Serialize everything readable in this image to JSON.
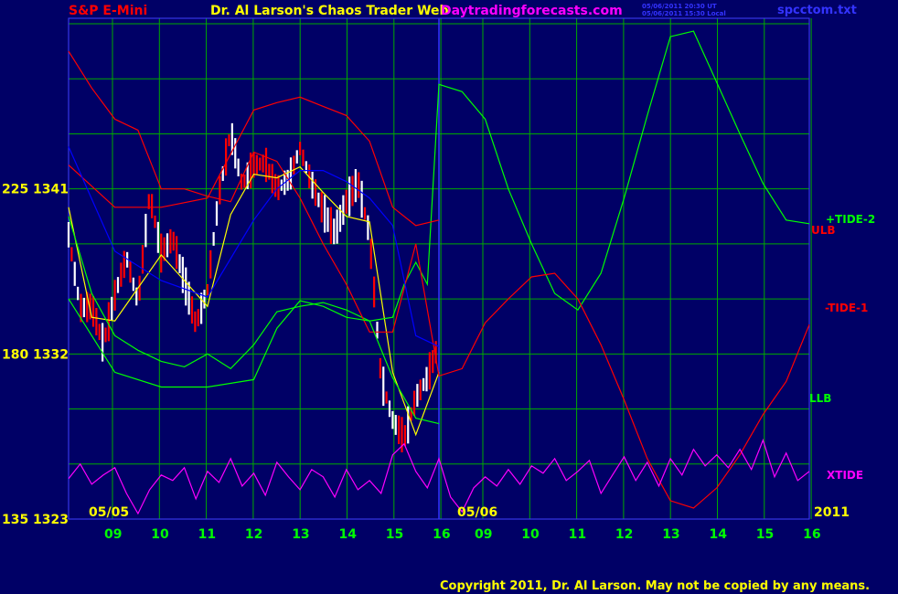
{
  "header": {
    "instrument": "S&P E-Mini",
    "title": "Dr. Al Larson's Chaos Trader Web",
    "site": "Daytradingforecasts.com",
    "timestamp_ut": "05/06/2011 20:30 UT",
    "timestamp_local": "05/06/2011 15:30 Local",
    "file": "spcctom.txt"
  },
  "footer": {
    "copyright": "Copyright 2011, Dr. Al Larson.  May not be copied by any means."
  },
  "colors": {
    "background": "#000066",
    "grid": "#00AA00",
    "price_up": "#FFFFFF",
    "price_down": "#FF0000",
    "tide2": "#00FF00",
    "tide1": "#FF0000",
    "ulb": "#FF0000",
    "llb": "#00FF00",
    "xtide": "#FF00FF",
    "blue_avg": "#0000FF",
    "yellow_avg": "#FFFF00",
    "title_yellow": "#FFFF00",
    "label_green": "#00FF00",
    "label_red": "#FF0000",
    "label_magenta": "#FF00FF",
    "label_blue": "#0000FF"
  },
  "chart_data": {
    "type": "line",
    "y_axis": {
      "ticks": [
        {
          "left": "225",
          "right": "1341",
          "price": 1341
        },
        {
          "left": "180",
          "right": "1332",
          "price": 1332
        },
        {
          "left": "135",
          "right": "1323",
          "price": 1323
        }
      ],
      "ylim": [
        1323,
        1350.3
      ]
    },
    "x_axis": {
      "hours_day1": [
        "09",
        "10",
        "11",
        "12",
        "13",
        "14",
        "15",
        "16"
      ],
      "hours_day2": [
        "09",
        "10",
        "11",
        "12",
        "13",
        "14",
        "15",
        "16"
      ],
      "date_labels": [
        "05/05",
        "05/06",
        "2011"
      ]
    },
    "right_labels": [
      "+TIDE-2",
      "ULB",
      "-TIDE-1",
      "LLB",
      "XTIDE"
    ],
    "series": [
      {
        "name": "+TIDE-2",
        "x": [
          0,
          0.5,
          1,
          1.5,
          2,
          2.5,
          3,
          3.5,
          4,
          4.5,
          5,
          5.5,
          6,
          6.5,
          7,
          7.25,
          7.5,
          7.75,
          8,
          8.5,
          9,
          9.5,
          10,
          10.5,
          11,
          11.5,
          12,
          12.5,
          13,
          13.5,
          14,
          14.5,
          15,
          15.5,
          16
        ],
        "y": [
          1339.5,
          1335.3,
          1333,
          1332.2,
          1331.6,
          1331.3,
          1332,
          1331.2,
          1332.5,
          1334.3,
          1334.6,
          1334.8,
          1334.4,
          1333.8,
          1334,
          1335.8,
          1337,
          1335.8,
          1346.7,
          1346.3,
          1344.8,
          1341,
          1338,
          1335.3,
          1334.4,
          1336.4,
          1340.5,
          1345,
          1349.3,
          1349.6,
          1346.8,
          1344,
          1341.3,
          1339.3,
          1339.1
        ]
      },
      {
        "name": "-TIDE-1",
        "x": [
          0,
          0.5,
          1,
          1.5,
          2,
          2.5,
          3,
          3.5,
          4,
          4.5,
          5,
          5.5,
          6,
          6.5,
          7,
          7.5,
          8,
          8.5,
          9,
          9.5,
          10,
          10.5,
          11,
          11.5,
          12,
          12.5,
          13,
          13.5,
          14,
          14.5,
          15,
          15.5,
          16
        ],
        "y": [
          1348.5,
          1346.5,
          1344.8,
          1344.2,
          1341,
          1341,
          1340.6,
          1340.3,
          1343,
          1342.5,
          1340.5,
          1338,
          1335.8,
          1333.2,
          1333.2,
          1338,
          1330.8,
          1331.2,
          1333.7,
          1335,
          1336.2,
          1336.4,
          1335,
          1332.5,
          1329.5,
          1326.3,
          1324,
          1323.6,
          1324.7,
          1326.5,
          1328.7,
          1330.5,
          1333.6
        ]
      },
      {
        "name": "ULB",
        "x": [
          0,
          1,
          2,
          3,
          4,
          4.5,
          5,
          5.5,
          6,
          6.5,
          7,
          7.5,
          8
        ],
        "y": [
          1342.3,
          1340,
          1340,
          1340.5,
          1345.3,
          1345.7,
          1346,
          1345.5,
          1345,
          1343.6,
          1340,
          1339,
          1339.3
        ]
      },
      {
        "name": "LLB",
        "x": [
          0,
          1,
          2,
          3,
          4,
          4.5,
          5,
          5.5,
          6,
          6.5,
          7,
          7.5,
          8
        ],
        "y": [
          1335,
          1331,
          1330.2,
          1330.2,
          1330.6,
          1333.4,
          1334.9,
          1334.6,
          1334,
          1333.8,
          1330.7,
          1328.5,
          1328.2
        ]
      },
      {
        "name": "blue average",
        "x": [
          0,
          1,
          2,
          3,
          4,
          4.5,
          5,
          5.5,
          6,
          6.5,
          7,
          7.5,
          8
        ],
        "y": [
          1343.3,
          1337.6,
          1336,
          1335.1,
          1339.3,
          1341,
          1342,
          1342,
          1341.4,
          1340.5,
          1339,
          1333,
          1332.4
        ]
      },
      {
        "name": "XTIDE",
        "x": [
          0,
          0.25,
          0.5,
          0.75,
          1,
          1.25,
          1.5,
          1.75,
          2,
          2.25,
          2.5,
          2.75,
          3,
          3.25,
          3.5,
          3.75,
          4,
          4.25,
          4.5,
          4.75,
          5,
          5.25,
          5.5,
          5.75,
          6,
          6.25,
          6.5,
          6.75,
          7,
          7.25,
          7.5,
          7.75,
          8,
          8.25,
          8.5,
          8.75,
          9,
          9.25,
          9.5,
          9.75,
          10,
          10.25,
          10.5,
          10.75,
          11,
          11.25,
          11.5,
          11.75,
          12,
          12.25,
          12.5,
          12.75,
          13,
          13.25,
          13.5,
          13.75,
          14,
          14.25,
          14.5,
          14.75,
          15,
          15.25,
          15.5,
          15.75,
          16
        ],
        "y": [
          1325.2,
          1326,
          1324.9,
          1325.4,
          1325.8,
          1324.4,
          1323.3,
          1324.6,
          1325.4,
          1325.1,
          1325.8,
          1324.1,
          1325.6,
          1325,
          1326.3,
          1324.8,
          1325.5,
          1324.3,
          1326.1,
          1325.3,
          1324.6,
          1325.7,
          1325.3,
          1324.2,
          1325.7,
          1324.6,
          1325.1,
          1324.4,
          1326.5,
          1327.1,
          1325.6,
          1324.7,
          1326.3,
          1324.2,
          1323.4,
          1324.7,
          1325.3,
          1324.8,
          1325.7,
          1324.9,
          1325.9,
          1325.5,
          1326.3,
          1325.1,
          1325.6,
          1326.2,
          1324.4,
          1325.4,
          1326.4,
          1325.1,
          1326.1,
          1324.8,
          1326.3,
          1325.4,
          1326.8,
          1325.9,
          1326.5,
          1325.8,
          1326.8,
          1325.7,
          1327.3,
          1325.3,
          1326.6,
          1325.1,
          1325.6
        ]
      }
    ],
    "price_bars": {
      "x_range": [
        0,
        8
      ],
      "close_path": {
        "x": [
          0,
          0.25,
          0.5,
          0.75,
          1,
          1.25,
          1.5,
          1.75,
          2,
          2.25,
          2.5,
          2.75,
          3,
          3.25,
          3.5,
          3.75,
          4,
          4.25,
          4.5,
          4.75,
          5,
          5.25,
          5.5,
          5.75,
          6,
          6.25,
          6.5,
          6.75,
          7,
          7.25,
          7.5,
          7.75,
          8
        ],
        "y": [
          1338.5,
          1334.5,
          1334.6,
          1332.5,
          1335.2,
          1337.3,
          1334.8,
          1340.7,
          1337.5,
          1338.3,
          1336,
          1333.6,
          1335.5,
          1340.7,
          1344.1,
          1341.2,
          1342.3,
          1342.4,
          1341,
          1341.5,
          1343.2,
          1341.3,
          1339.8,
          1338.6,
          1340.3,
          1341.4,
          1338.5,
          1330.7,
          1328.4,
          1327.4,
          1329.6,
          1330.7,
          1332.6
        ]
      },
      "yellow_average": {
        "x": [
          0,
          0.5,
          1,
          1.5,
          2,
          2.5,
          3,
          3.5,
          4,
          4.5,
          5,
          5.5,
          6,
          6.5,
          7,
          7.5,
          8
        ],
        "y": [
          1340,
          1334,
          1333.8,
          1335.6,
          1337.4,
          1336,
          1334.6,
          1339.6,
          1341.8,
          1341.6,
          1342.2,
          1340.8,
          1339.5,
          1339.2,
          1331,
          1327.6,
          1331
        ]
      }
    }
  }
}
